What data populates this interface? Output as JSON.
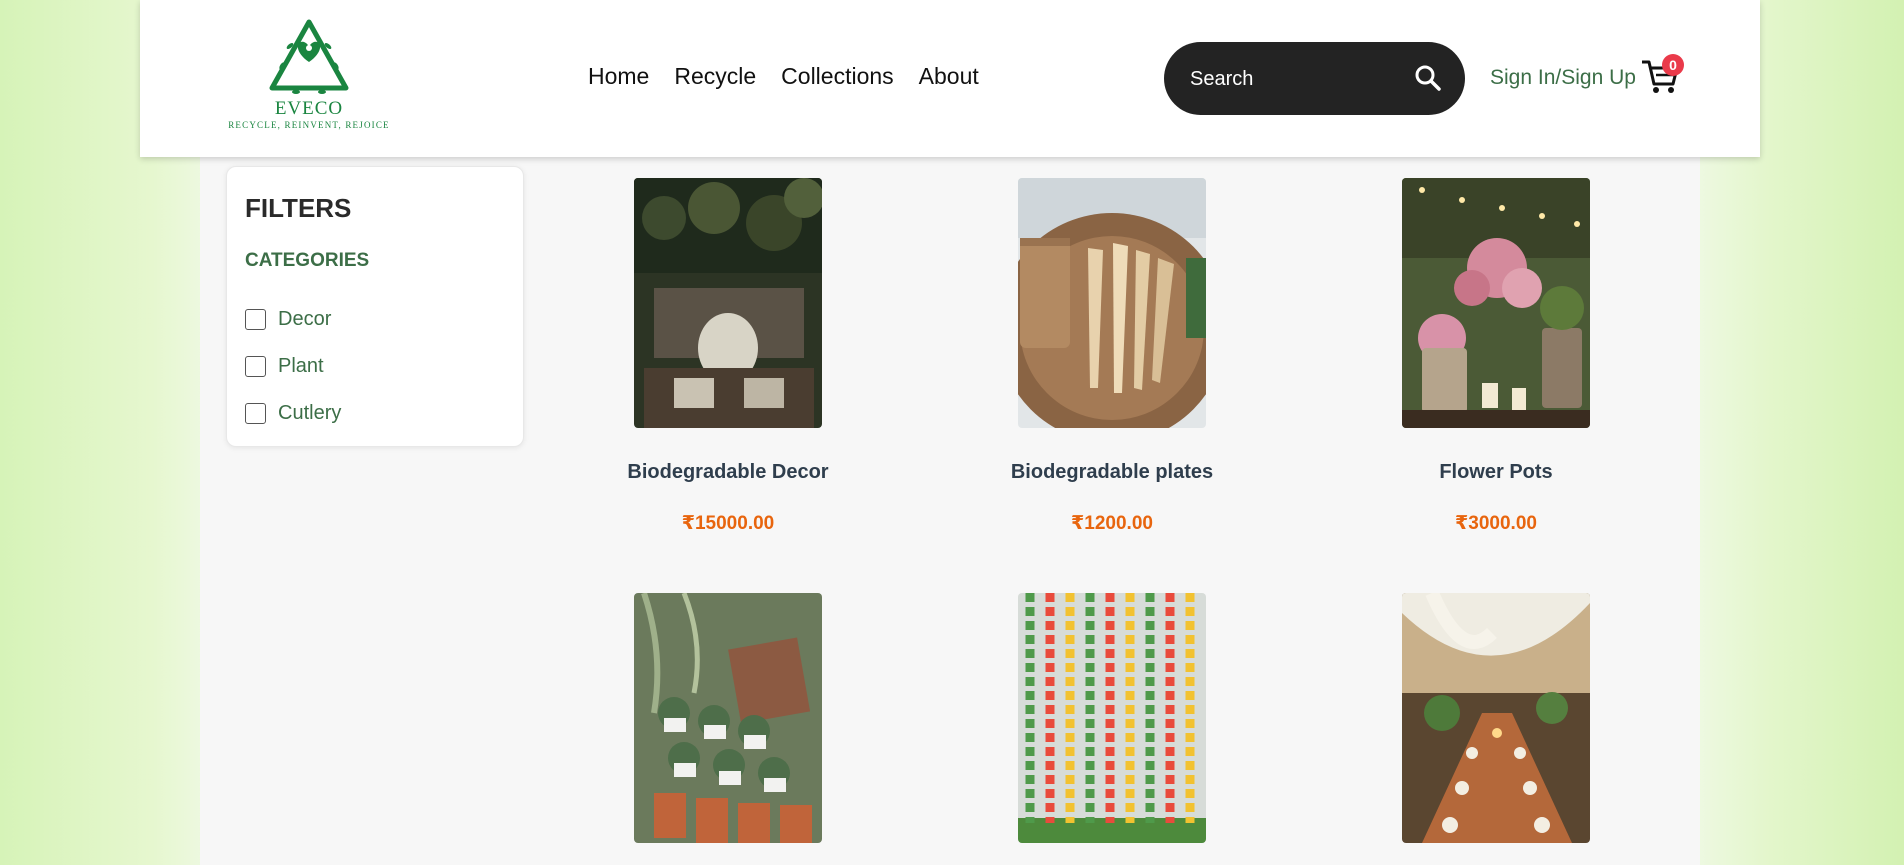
{
  "brand": {
    "name": "EVECO",
    "tagline": "RECYCLE, REINVENT, REJOICE",
    "logo_icon": "heart-recycle-triangle-icon",
    "color": "#1a8540"
  },
  "nav": {
    "items": [
      {
        "label": "Home"
      },
      {
        "label": "Recycle"
      },
      {
        "label": "Collections"
      },
      {
        "label": "About"
      }
    ]
  },
  "search": {
    "placeholder": "Search",
    "icon": "search-icon"
  },
  "auth": {
    "label": "Sign In/Sign Up"
  },
  "cart": {
    "count": "0",
    "icon": "cart-icon",
    "badge_color": "#ea3a4a"
  },
  "filters": {
    "title": "FILTERS",
    "categories_title": "CATEGORIES",
    "options": [
      {
        "label": "Decor",
        "checked": false
      },
      {
        "label": "Plant",
        "checked": false
      },
      {
        "label": "Cutlery",
        "checked": false
      }
    ]
  },
  "products": [
    {
      "name": "Biodegradable Decor",
      "price": "₹15000.00"
    },
    {
      "name": "Biodegradable plates",
      "price": "₹1200.00"
    },
    {
      "name": "Flower Pots",
      "price": "₹3000.00"
    },
    {
      "name": "",
      "price": ""
    },
    {
      "name": "",
      "price": ""
    },
    {
      "name": "",
      "price": ""
    }
  ],
  "colors": {
    "accent_green": "#3c6e47",
    "price_orange": "#e8650e",
    "search_bg": "#232323"
  }
}
